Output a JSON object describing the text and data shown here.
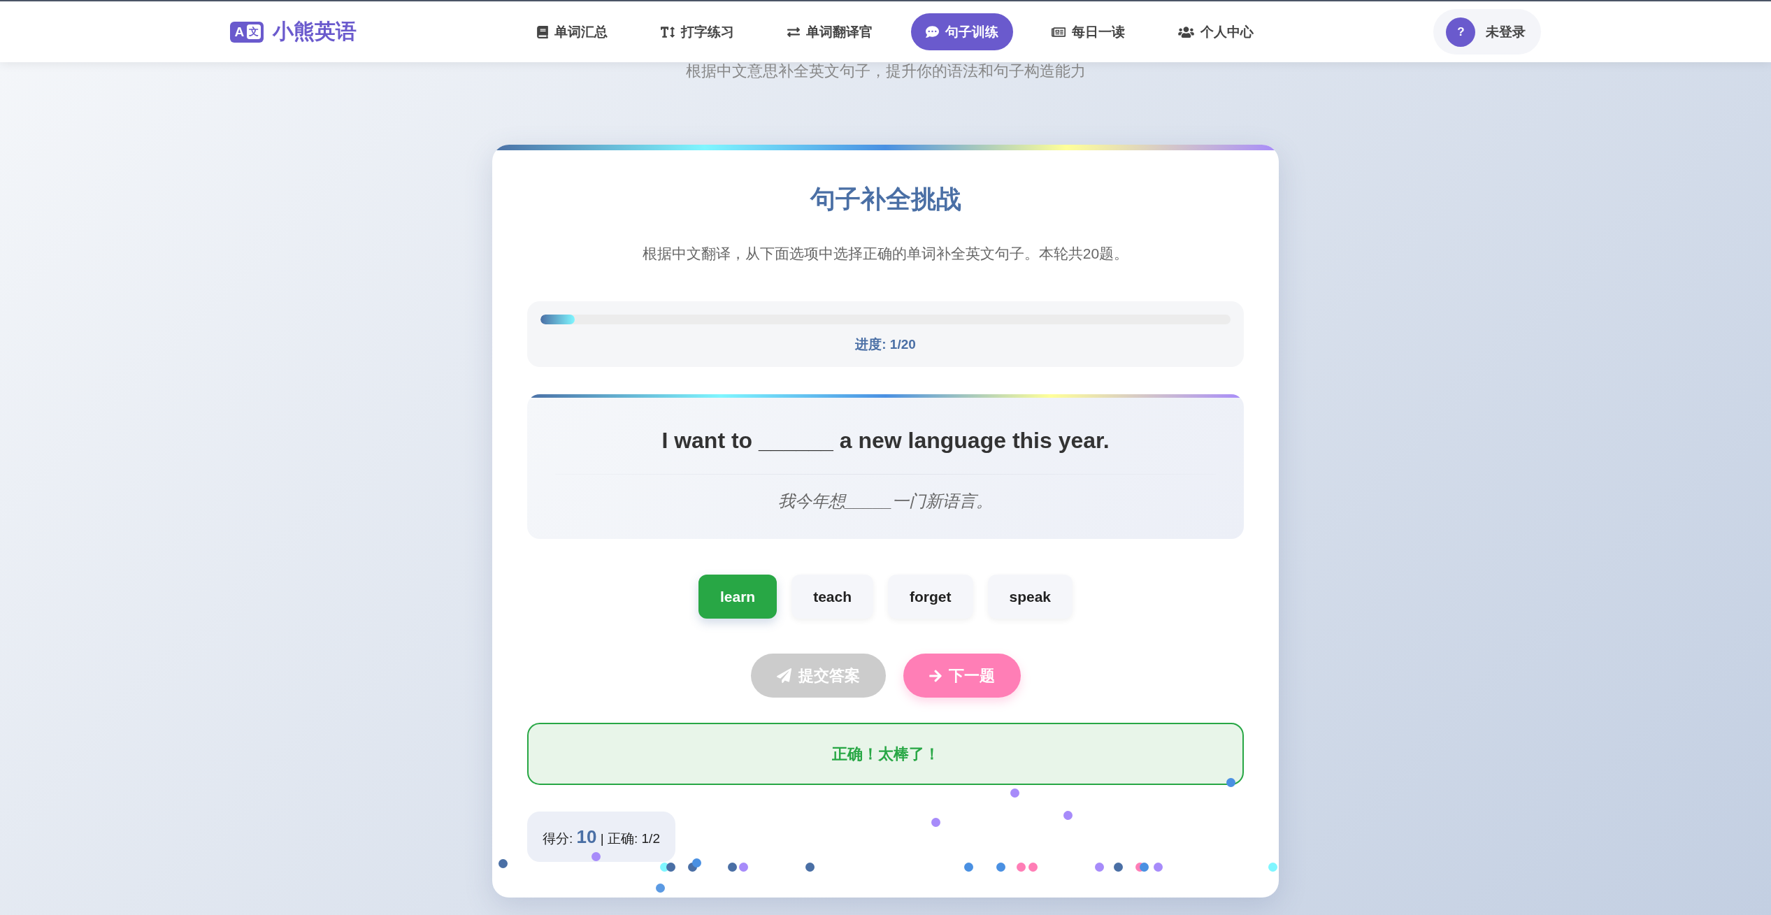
{
  "header": {
    "logo_mark": {
      "letter": "A",
      "character": "文"
    },
    "logo": "小熊英语",
    "nav": [
      {
        "label": "单词汇总",
        "selected": false
      },
      {
        "label": "打字练习",
        "selected": false
      },
      {
        "label": "单词翻译官",
        "selected": false
      },
      {
        "label": "句子训练",
        "selected": true
      },
      {
        "label": "每日一读",
        "selected": false
      },
      {
        "label": "个人中心",
        "selected": false
      }
    ],
    "user": {
      "avatar": "?",
      "label": "未登录"
    }
  },
  "subtitle": "根据中文意思补全英文句子，提升你的语法和句子构造能力",
  "card": {
    "title": "句子补全挑战",
    "description": "根据中文翻译，从下面选项中选择正确的单词补全英文句子。本轮共20题。",
    "progress": {
      "level": 0.05,
      "label": "进度: 1/20"
    },
    "question": {
      "sentence": "I want to ______ a new language this year.",
      "translation": "我今年想_____一门新语言。"
    },
    "options": [
      {
        "label": "learn",
        "selected": true
      },
      {
        "label": "teach",
        "selected": false
      },
      {
        "label": "forget",
        "selected": false
      },
      {
        "label": "speak",
        "selected": false
      }
    ],
    "actions": [
      {
        "kind": "submit",
        "label": "提交答案",
        "disabled": true
      },
      {
        "kind": "next",
        "label": "下一题",
        "disabled": false
      }
    ],
    "feedback": {
      "kind": "correct",
      "text": "正确！太棒了！"
    },
    "score": "得分: **10** | 正确: 1/2"
  },
  "confetti": [
    {
      "color": "#4a6fa5"
    },
    {
      "color": "#a78bfa"
    },
    {
      "color": "#5b9ae3"
    },
    {
      "color": "#7ff6ff"
    },
    {
      "color": "#4a6fa5"
    },
    {
      "color": "#4a6fa5"
    },
    {
      "color": "#4a90e2"
    },
    {
      "color": "#4a6fa5"
    },
    {
      "color": "#a78bfa"
    },
    {
      "color": "#4a6fa5"
    },
    {
      "color": "#a78bfa"
    },
    {
      "color": "#4a90e2"
    },
    {
      "color": "#4a90e2"
    },
    {
      "color": "#ff7eb6"
    },
    {
      "color": "#ff7eb6"
    },
    {
      "color": "#a78bfa"
    },
    {
      "color": "#a78bfa"
    },
    {
      "color": "#a78bfa"
    },
    {
      "color": "#4a6fa5"
    },
    {
      "color": "#ff7eb6"
    },
    {
      "color": "#4a90e2"
    },
    {
      "color": "#a78bfa"
    },
    {
      "color": "#4a90e2"
    },
    {
      "color": "#7ff6ff"
    }
  ]
}
